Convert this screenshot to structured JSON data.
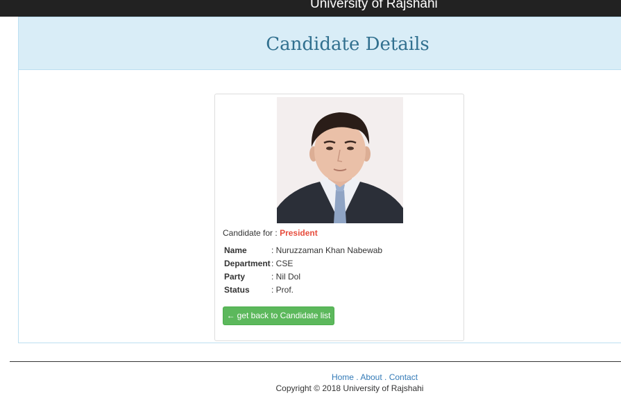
{
  "navbar": {
    "title": "University of Rajshahi"
  },
  "panel": {
    "title": "Candidate Details"
  },
  "candidate": {
    "for_label": "Candidate for :",
    "position": "President",
    "fields": [
      {
        "label": "Name",
        "value": ": Nuruzzaman Khan Nabewab"
      },
      {
        "label": "Department",
        "value": ": CSE"
      },
      {
        "label": "Party",
        "value": ": Nil Dol"
      },
      {
        "label": "Status",
        "value": ": Prof."
      }
    ],
    "back_button": {
      "icon": "arrow-left-icon",
      "label": "get back to Candidate list"
    }
  },
  "footer": {
    "links": [
      "Home",
      "About",
      "Contact"
    ],
    "separator": " . ",
    "copyright": "Copyright © 2018 University of Rajshahi"
  },
  "colors": {
    "navbar_bg": "#222222",
    "heading_bg": "#d9edf7",
    "heading_text": "#31708f",
    "position_text": "#e74c3c",
    "button_bg": "#5cb85c",
    "link": "#337ab7"
  }
}
